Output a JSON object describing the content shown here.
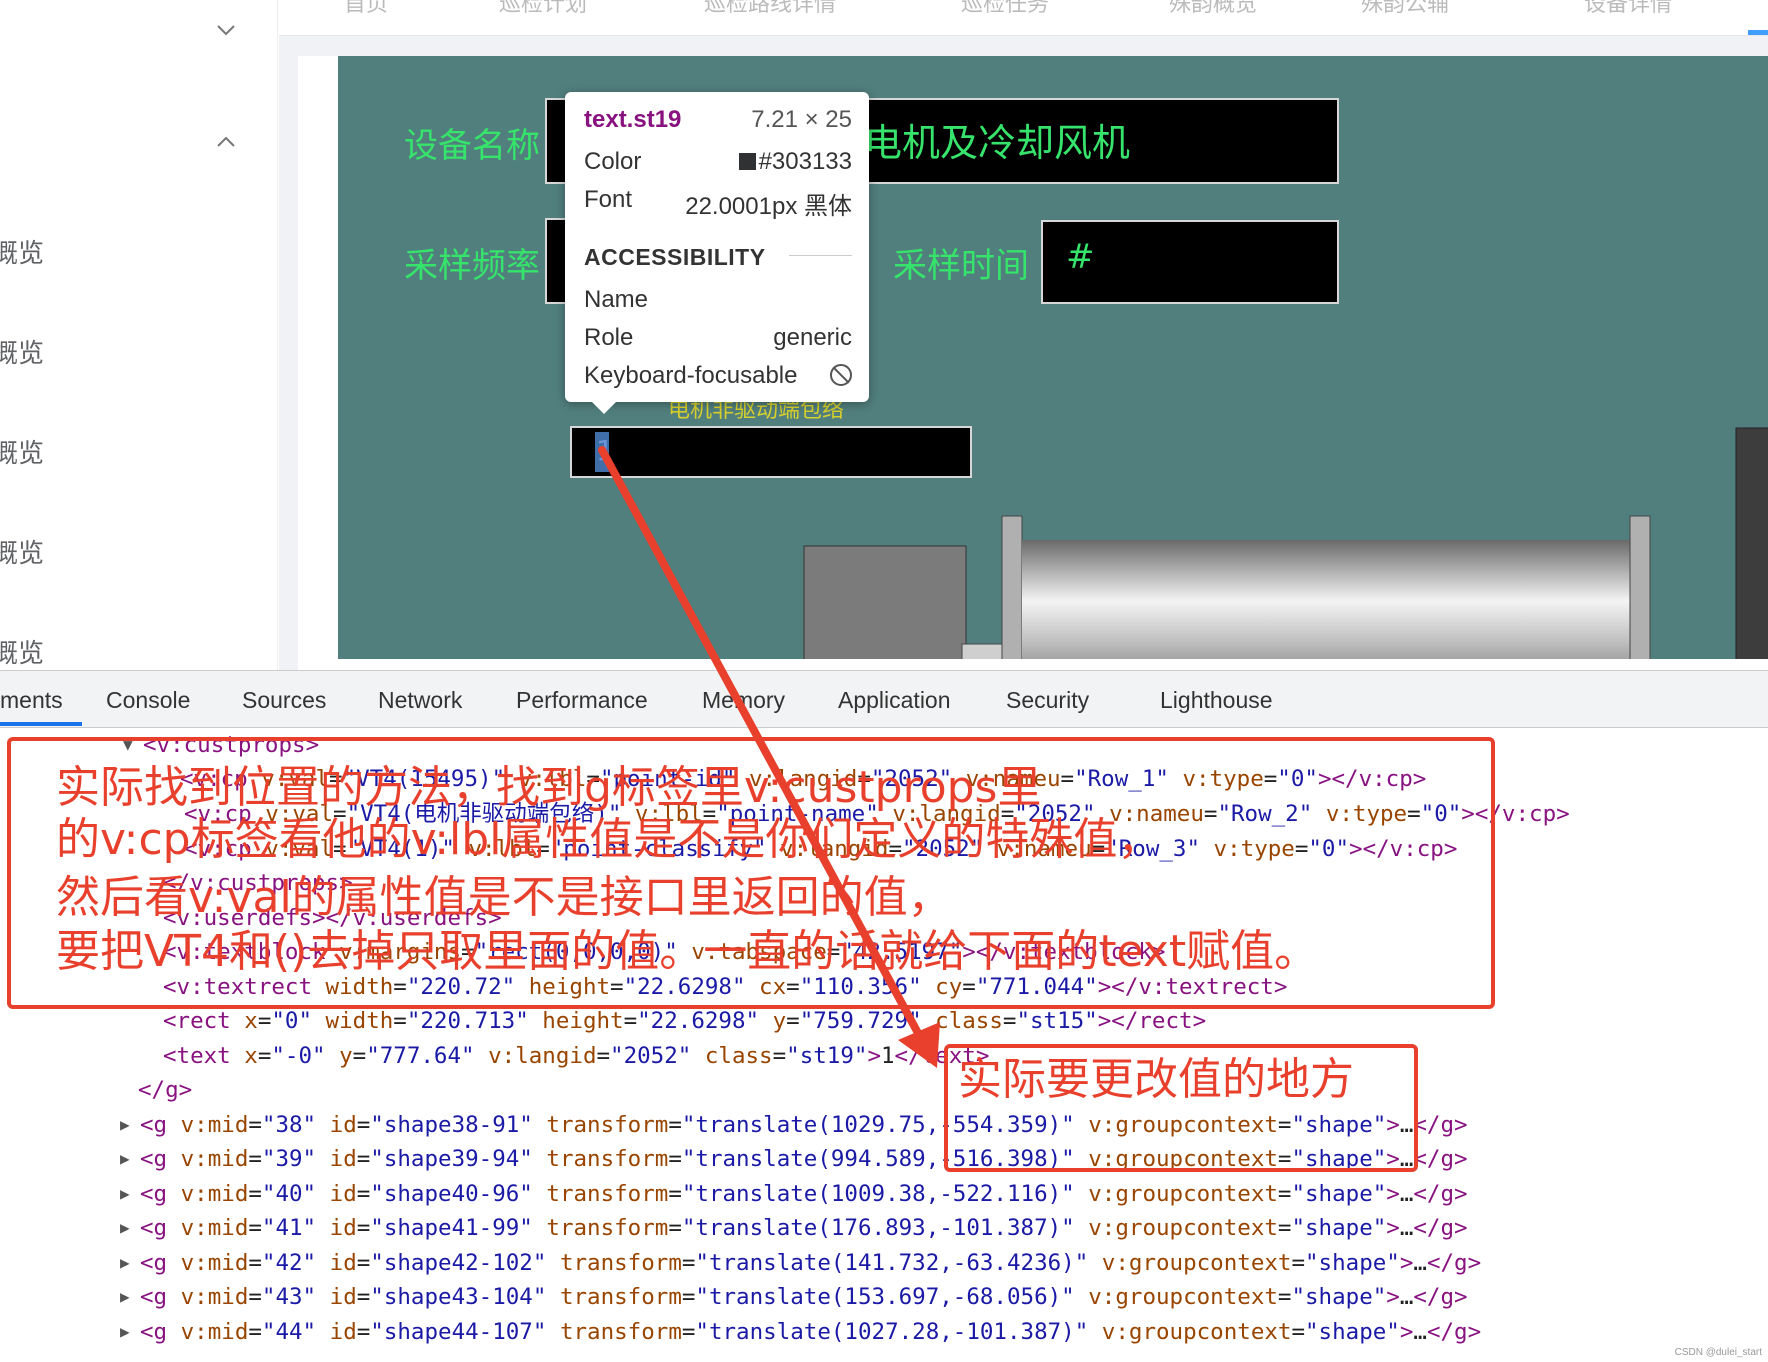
{
  "sidebar": {
    "items": [
      "概览",
      "概览",
      "概览",
      "概览",
      "概览"
    ]
  },
  "topnav": {
    "tabs": [
      "首页",
      "巡检计划",
      "巡检路线详情",
      "巡检任务",
      "殊韵概览",
      "殊韵公辅",
      "设备详情"
    ]
  },
  "scada": {
    "device_name_label": "设备名称",
    "device_name_value": "电机及冷却风机",
    "sample_freq_label": "采样频率",
    "sample_time_label": "采样时间",
    "sample_time_value": "#",
    "point_label": "电机非驱动端包络",
    "selected_text": "1"
  },
  "tooltip": {
    "selector": "text.st19",
    "dimensions": "7.21 × 25",
    "color_label": "Color",
    "color_value": "#303133",
    "font_label": "Font",
    "font_value": "22.0001px 黑体",
    "section_title": "ACCESSIBILITY",
    "name_label": "Name",
    "role_label": "Role",
    "role_value": "generic",
    "focus_label": "Keyboard-focusable"
  },
  "devtools": {
    "tabs": [
      "ments",
      "Console",
      "Sources",
      "Network",
      "Performance",
      "Memory",
      "Application",
      "Security",
      "Lighthouse"
    ],
    "active_tab": "ments"
  },
  "code_lines": [
    "<v:custprops>",
    "<v:cp v:val=\"VT4(15495)\" v:lbl=\"point-id\" v:langid=\"2052\" v:nameu=\"Row_1\" v:type=\"0\"></v:cp>",
    "<v:cp v:val=\"VT4(电机非驱动端包络)\" v:lbl=\"point-name\" v:langid=\"2052\" v:nameu=\"Row_2\" v:type=\"0\"></v:cp>",
    "<v:cp v:val=\"VT4(1)\" v:lbl=\"point-classify\" v:langid=\"2052\" v:nameu=\"Row_3\" v:type=\"0\"></v:cp>",
    "</v:custprops>",
    "<v:userdefs></v:userdefs>",
    "<v:textblock v:margins=\"rect(0,0,0,0)\" v:tabspace=\"42.5197\"></v:textblock>",
    "<v:textrect width=\"220.72\" height=\"22.6298\" cx=\"110.356\" cy=\"771.044\"></v:textrect>",
    "<rect x=\"0\" width=\"220.713\" height=\"22.6298\" y=\"759.729\" class=\"st15\"></rect>",
    "<text x=\"-0\" y=\"777.64\" v:langid=\"2052\" class=\"st19\">1</text>",
    "</g>",
    "<g v:mid=\"38\" id=\"shape38-91\" transform=\"translate(1029.75,-554.359)\" v:groupcontext=\"shape\">…</g>",
    "<g v:mid=\"39\" id=\"shape39-94\" transform=\"translate(994.589,-516.398)\" v:groupcontext=\"shape\">…</g>",
    "<g v:mid=\"40\" id=\"shape40-96\" transform=\"translate(1009.38,-522.116)\" v:groupcontext=\"shape\">…</g>",
    "<g v:mid=\"41\" id=\"shape41-99\" transform=\"translate(176.893,-101.387)\" v:groupcontext=\"shape\">…</g>",
    "<g v:mid=\"42\" id=\"shape42-102\" transform=\"translate(141.732,-63.4236)\" v:groupcontext=\"shape\">…</g>",
    "<g v:mid=\"43\" id=\"shape43-104\" transform=\"translate(153.697,-68.056)\" v:groupcontext=\"shape\">…</g>",
    "<g v:mid=\"44\" id=\"shape44-107\" transform=\"translate(1027.28,-101.387)\" v:groupcontext=\"shape\">…</g>"
  ],
  "annotations": {
    "main_lines": [
      "实际找到位置的方法，找到g标签里v:custprops里",
      "的v:cp标签看他的v:lbl属性值是不是你们定义的特殊值，",
      "然后看v:val的属性值是不是接口里返回的值，",
      "要把VT4和()去掉只取里面的值。一直的话就给下面的text赋值。"
    ],
    "target_note": "实际要更改值的地方"
  },
  "watermark": "CSDN @dulei_start",
  "colors": {
    "scada_bg": "#517f7e",
    "label_green": "#36e36b",
    "annotation_red": "#e8402c",
    "tag_purple": "#881280",
    "attr_brown": "#994500",
    "value_blue": "#1a1aa6"
  }
}
